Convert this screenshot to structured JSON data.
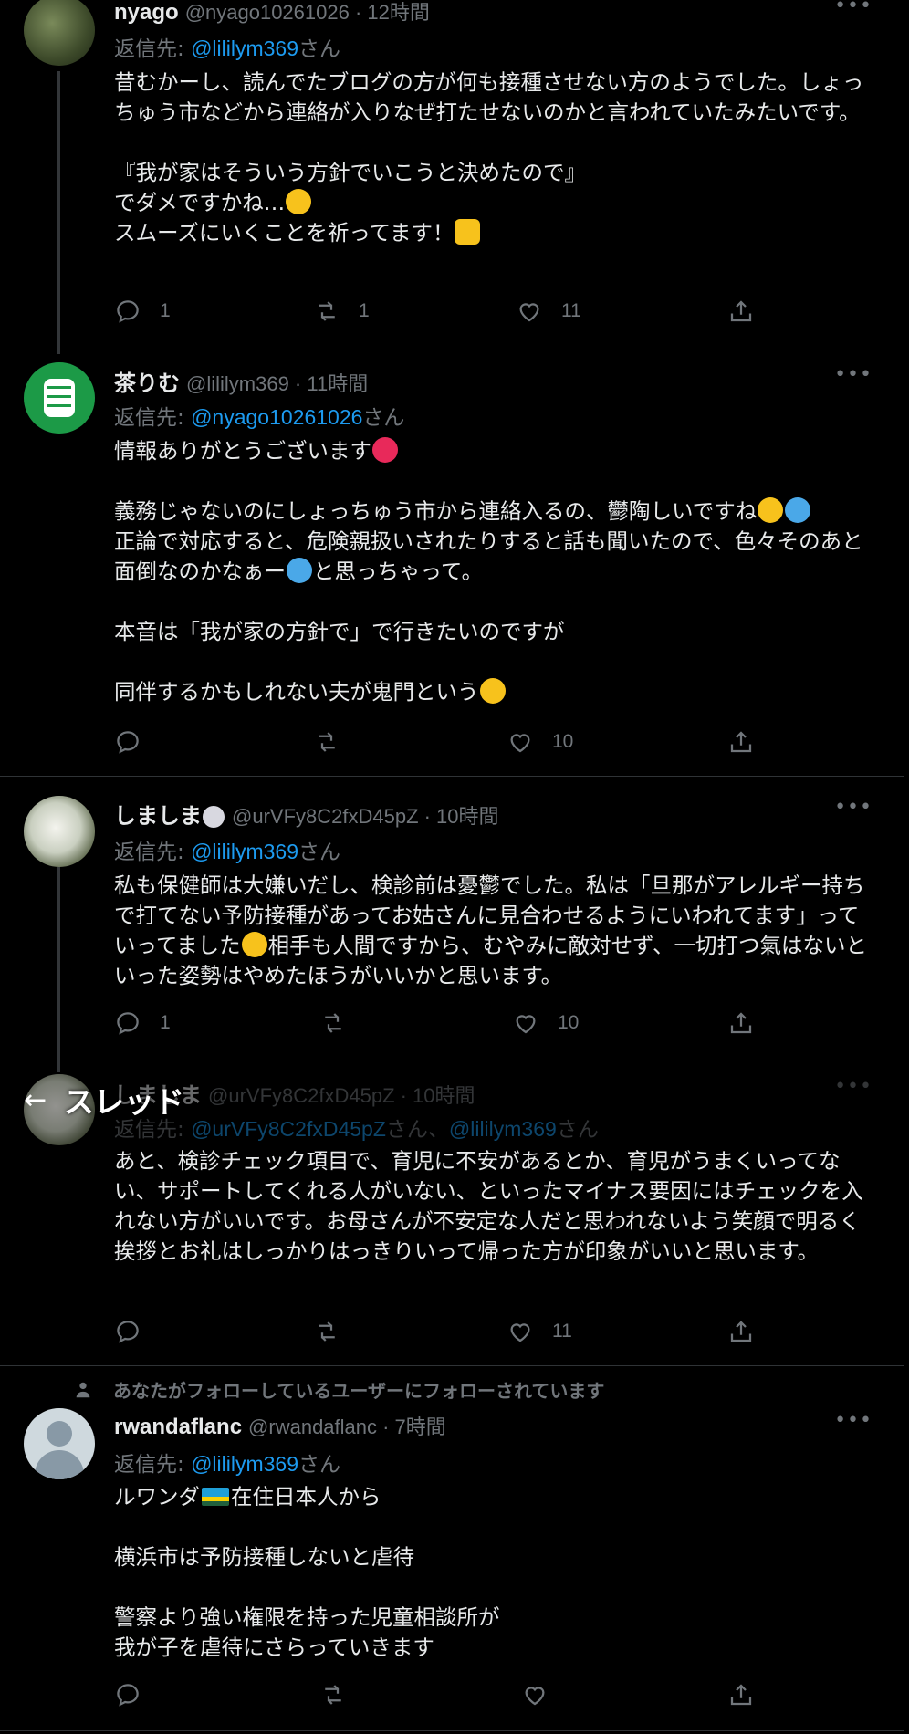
{
  "tweets": [
    {
      "name": "nyago",
      "handle": "@nyago10261026 · 12時間",
      "reply_prefix": "返信先: ",
      "reply_mention": "@lililym369",
      "reply_suffix": "さん",
      "text_1": "昔むかーし、読んでたブログの方が何も接種させない方のようでした。しょっちゅう市などから連絡が入りなぜ打たせないのかと言われていたみたいです。",
      "text_2": "『我が家はそういう方針でいこうと決めたので』",
      "text_3": "でダメですかね…",
      "text_4": "スムーズにいくことを祈ってます！",
      "replies": "1",
      "retweets": "1",
      "likes": "11"
    },
    {
      "name": "茶りむ",
      "handle": "@lililym369 · 11時間",
      "reply_prefix": "返信先: ",
      "reply_mention": "@nyago10261026",
      "reply_suffix": "さん",
      "text_1": "情報ありがとうございます",
      "text_2": "義務じゃないのにしょっちゅう市から連絡入るの、鬱陶しいですね",
      "text_3": "正論で対応すると、危険親扱いされたりすると話も聞いたので、色々そのあと面倒なのかなぁー",
      "text_3b": "と思っちゃって。",
      "text_4": "本音は「我が家の方針で」で行きたいのですが",
      "text_5": "同伴するかもしれない夫が鬼門という",
      "replies": "",
      "retweets": "",
      "likes": "10"
    },
    {
      "name": "しましま",
      "handle": "@urVFy8C2fxD45pZ · 10時間",
      "reply_prefix": "返信先: ",
      "reply_mention": "@lililym369",
      "reply_suffix": "さん",
      "text_1": "私も保健師は大嫌いだし、検診前は憂鬱でした。私は「旦那がアレルギー持ちで打てない予防接種があってお姑さんに見合わせるようにいわれてます」っていってました",
      "text_2": "相手も人間ですから、むやみに敵対せず、一切打つ氣はないといった姿勢はやめたほうがいいかと思います。",
      "replies": "1",
      "retweets": "",
      "likes": "10"
    },
    {
      "name": "しましま",
      "handle": "@urVFy8C2fxD45pZ · 10時間",
      "reply_prefix": "返信先: ",
      "reply_mention": "@urVFy8C2fxD45pZ",
      "reply_mid": "さん、",
      "reply_mention2": "@lililym369",
      "reply_suffix": "さん",
      "text_1": "あと、検診チェック項目で、育児に不安があるとか、育児がうまくいってない、サポートしてくれる人がいない、といったマイナス要因にはチェックを入れない方がいいです。お母さんが不安定な人だと思われないよう笑顔で明るく挨拶とお礼はしっかりはっきりいって帰った方が印象がいいと思います。",
      "replies": "",
      "retweets": "",
      "likes": "11"
    },
    {
      "social_context": "あなたがフォローしているユーザーにフォローされています",
      "name": "rwandaflanc",
      "handle": "@rwandaflanc · 7時間",
      "reply_prefix": "返信先: ",
      "reply_mention": "@lililym369",
      "reply_suffix": "さん",
      "text_1a": "ルワンダ",
      "text_1b": "在住日本人から",
      "text_2": "横浜市は予防接種しないと虐待",
      "text_3": "警察より強い権限を持った児童相談所が",
      "text_4": "我が子を虐待にさらっていきます",
      "replies": "",
      "retweets": "",
      "likes": ""
    }
  ],
  "thread_nav": {
    "back_icon": "←",
    "label": "スレッド"
  },
  "more_icon": "•••",
  "colors": {
    "link": "#1d9bf0",
    "muted": "#71767b",
    "bg": "#000000",
    "text": "#e7e9ea"
  }
}
